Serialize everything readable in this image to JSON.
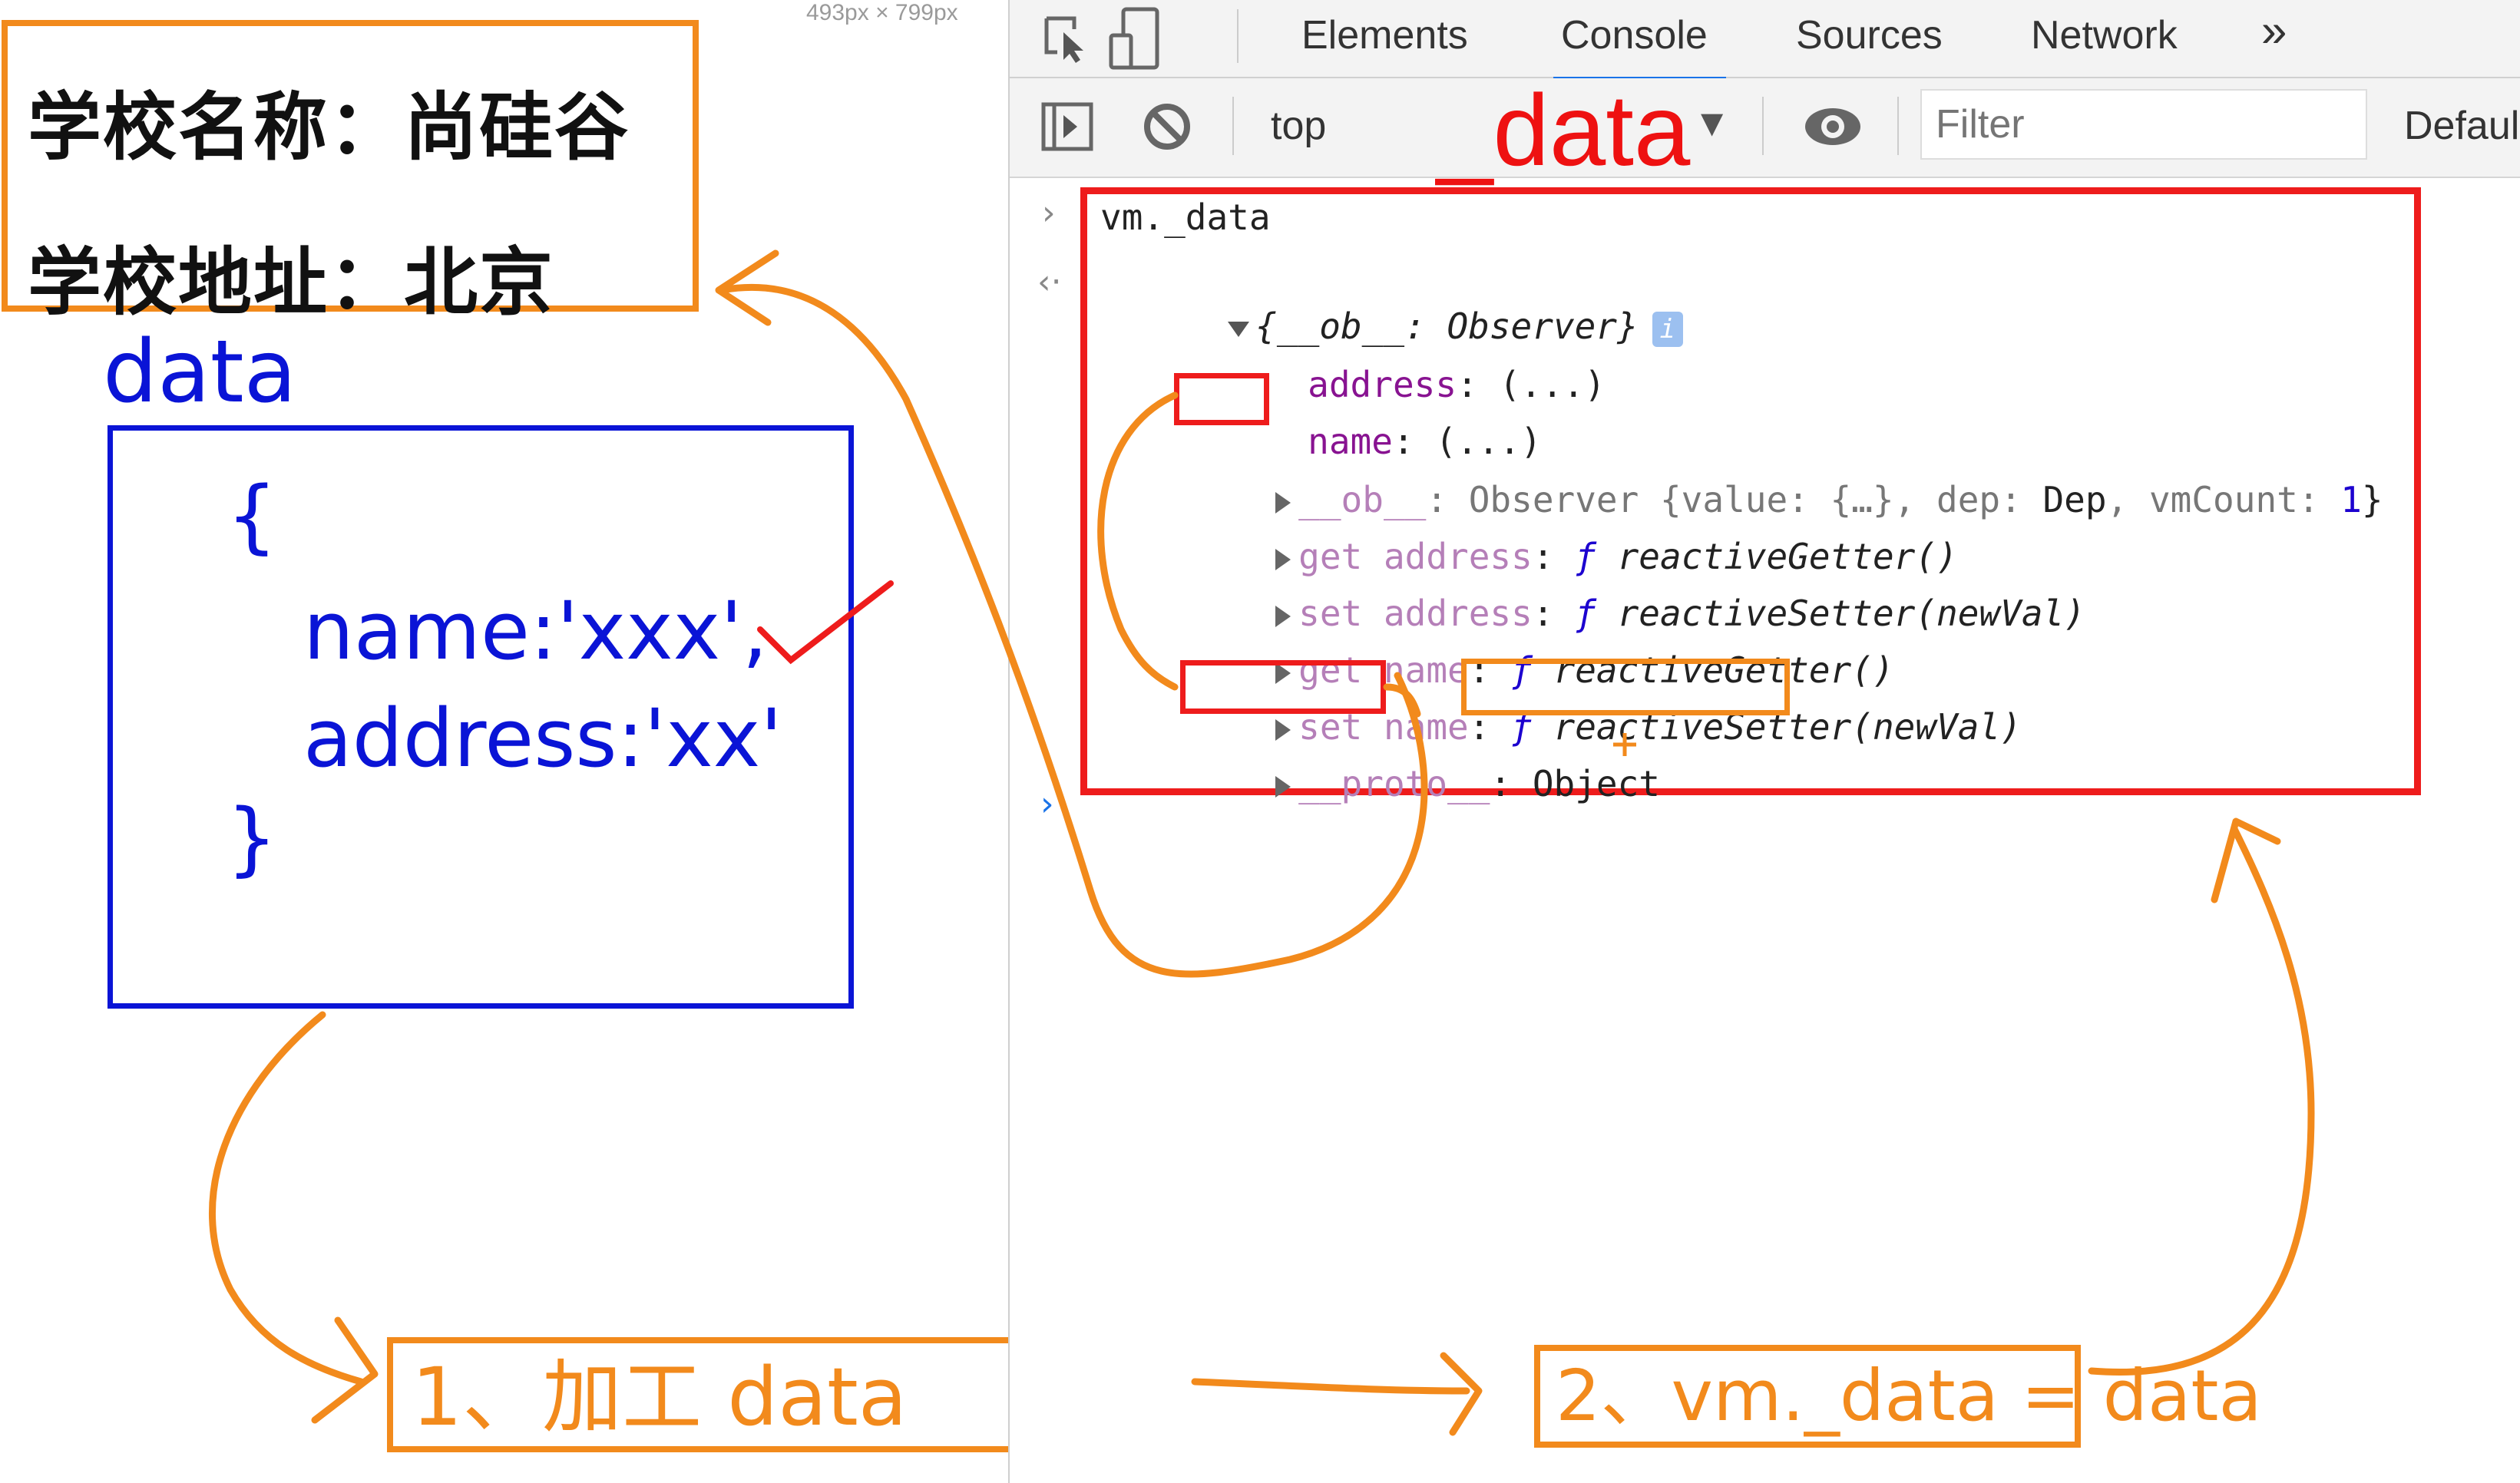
{
  "page": {
    "size_readout": "493px × 799px",
    "school_name_line": "学校名称：尚硅谷",
    "school_address_line": "学校地址：北京"
  },
  "annotation": {
    "data_label": "data",
    "data_object": {
      "open_brace": "{",
      "name_line": "name:'xxx',",
      "address_line": "address:'xx'",
      "close_brace": "}"
    },
    "toolbar_overlay_text": "_data",
    "step1": "1、加工 data",
    "step2": "2、vm._data = data",
    "colors": {
      "orange": "#f28a1c",
      "red": "#ee1c1c",
      "blue": "#0a14d6"
    }
  },
  "devtools": {
    "tabs": [
      {
        "label": "Elements",
        "active": false
      },
      {
        "label": "Console",
        "active": true
      },
      {
        "label": "Sources",
        "active": false
      },
      {
        "label": "Network",
        "active": false
      }
    ],
    "more_tabs_glyph": "»",
    "toolbar": {
      "context": "top",
      "filter_placeholder": "Filter",
      "levels": "Default levels"
    },
    "console": {
      "input_command": "vm._data",
      "result_summary_open": "{",
      "result_summary_key": "__ob__",
      "result_summary_sep": ": ",
      "result_summary_val": "Observer",
      "result_summary_close": "}",
      "info_badge": "i",
      "rows": [
        {
          "key": "address",
          "sep": ": ",
          "value": "(...)"
        },
        {
          "key": "name",
          "sep": ": ",
          "value": "(...)"
        },
        {
          "key": "__ob__",
          "sep": ": ",
          "value_prefix": "Observer {value: {…}, dep: ",
          "value_dep": "Dep",
          "value_mid": ", vmCount: ",
          "value_count": "1",
          "value_suffix": "}"
        },
        {
          "key": "get address",
          "sep": ": ",
          "f": "ƒ",
          "fn": "reactiveGetter()"
        },
        {
          "key": "set address",
          "sep": ": ",
          "f": "ƒ",
          "fn": "reactiveSetter",
          "args": "(newVal)"
        },
        {
          "key": "get name",
          "sep": ": ",
          "f": "ƒ",
          "fn": "reactiveGetter()"
        },
        {
          "key": "set name",
          "sep": ": ",
          "f": "ƒ",
          "fn": "reactiveSetter",
          "args": "(newVal)"
        },
        {
          "key": "__proto__",
          "sep": ": ",
          "value": "Object"
        }
      ]
    }
  }
}
